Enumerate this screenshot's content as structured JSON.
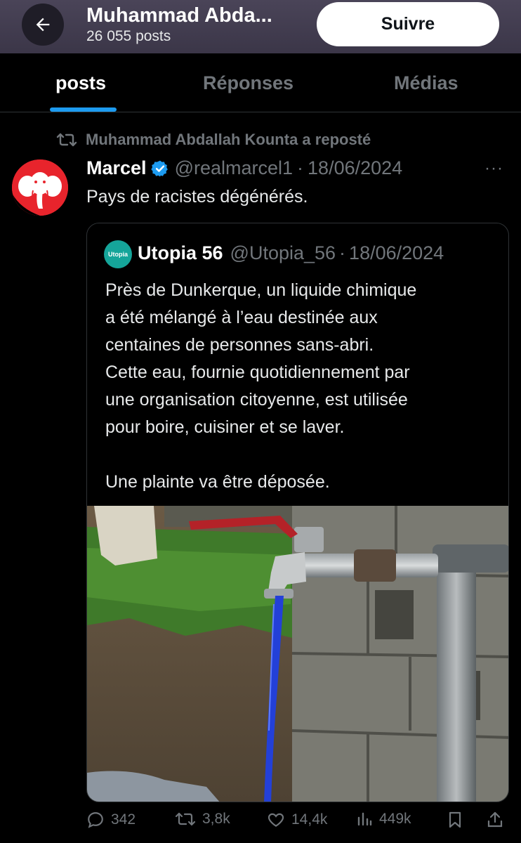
{
  "header": {
    "title": "Muhammad Abda...",
    "subtitle": "26 055 posts",
    "follow_label": "Suivre"
  },
  "tabs": [
    {
      "label": "posts",
      "active": true
    },
    {
      "label": "Réponses",
      "active": false
    },
    {
      "label": "Médias",
      "active": false
    }
  ],
  "post": {
    "repost_text": "Muhammad Abdallah Kounta a reposté",
    "author": {
      "name": "Marcel",
      "handle": "@realmarcel1",
      "verified": true
    },
    "date": "18/06/2024",
    "separator": "·",
    "more": "···",
    "text": "Pays de racistes dégénérés.",
    "quote": {
      "avatar_text": "Utopia",
      "author": {
        "name": "Utopia 56",
        "handle": "@Utopia_56"
      },
      "date": "18/06/2024",
      "text": "Près de Dunkerque, un liquide chimique\na été mélangé à l’eau destinée aux\ncentaines de personnes sans-abri.\nCette eau, fournie quotidiennement par\nune organisation citoyenne, est utilisée\npour boire, cuisiner et se laver.\n\nUne plainte va être déposée."
    },
    "actions": {
      "replies": "342",
      "reposts": "3,8k",
      "likes": "14,4k",
      "views": "449k"
    }
  },
  "colors": {
    "accent": "#1d9bf0",
    "header_bg": "#433e52",
    "muted": "#71767b",
    "water": "#2340d8",
    "tap_handle": "#c0262c"
  }
}
